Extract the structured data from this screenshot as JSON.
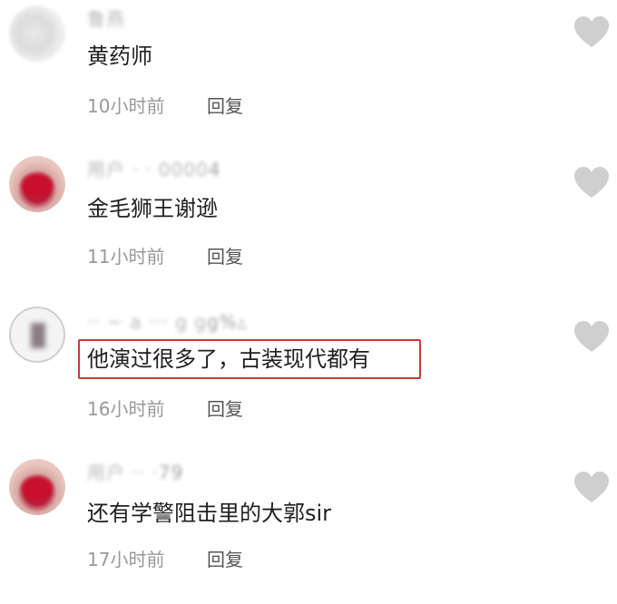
{
  "comments": [
    {
      "username": "鲁燕",
      "username_tail": "",
      "text": "黄药师",
      "time": "10小时前",
      "reply_label": "回复",
      "highlighted": false
    },
    {
      "username": "用户 · · 0000",
      "username_tail": "4",
      "text": "金毛狮王谢逊",
      "time": "11小时前",
      "reply_label": "回复",
      "highlighted": false
    },
    {
      "username": "·· ~ a ··· g g",
      "username_tail": "g%೭",
      "text": "他演过很多了，古装现代都有",
      "time": "16小时前",
      "reply_label": "回复",
      "highlighted": true
    },
    {
      "username": "用户 ·· ·",
      "username_tail": "79",
      "text": "还有学警阻击里的大郭sir",
      "time": "17小时前",
      "reply_label": "回复",
      "highlighted": false
    }
  ],
  "icons": {
    "like": "heart-icon"
  },
  "colors": {
    "highlight_border": "#c83a3a",
    "text": "#1f1f1f",
    "meta": "#999999",
    "reply": "#555555",
    "heart": "#cfcfcf"
  }
}
